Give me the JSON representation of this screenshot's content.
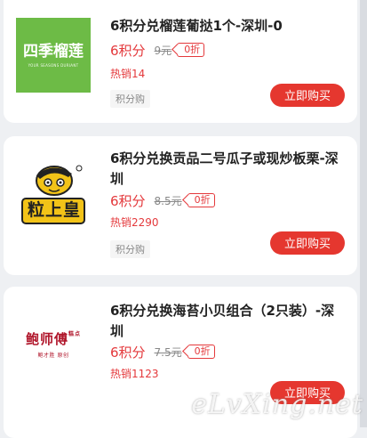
{
  "items": [
    {
      "logo_main": "四季榴莲",
      "logo_sub": "YOUR SEASONS DURIANT",
      "title": "6积分兑榴莲葡挞1个-深圳-0",
      "price": "6积分",
      "original_price": "9元",
      "discount": "0折",
      "sales": "热销14",
      "tag": "积分购",
      "button": "立即购买"
    },
    {
      "logo_main": "粒上皇",
      "title": "6积分兑换贡品二号瓜子或现炒板栗-深圳",
      "price": "6积分",
      "original_price": "8.5元",
      "discount": "0折",
      "sales": "热销2290",
      "tag": "积分购",
      "button": "立即购买"
    },
    {
      "logo_main": "鲍师傅",
      "logo_tag": "糕点",
      "logo_sub": "鲍才胜 原创",
      "title": "6积分兑换海苔小贝组合（2只装）-深圳",
      "price": "6积分",
      "original_price": "7.5元",
      "discount": "0折",
      "sales": "热销1123",
      "tag": "积分购",
      "button": "立即购买"
    }
  ],
  "watermark": "eLvXing.net",
  "colors": {
    "accent": "#e5372f",
    "durian_green": "#6dbb46",
    "bao_red": "#b0162b",
    "seed_yellow": "#f2c318"
  }
}
